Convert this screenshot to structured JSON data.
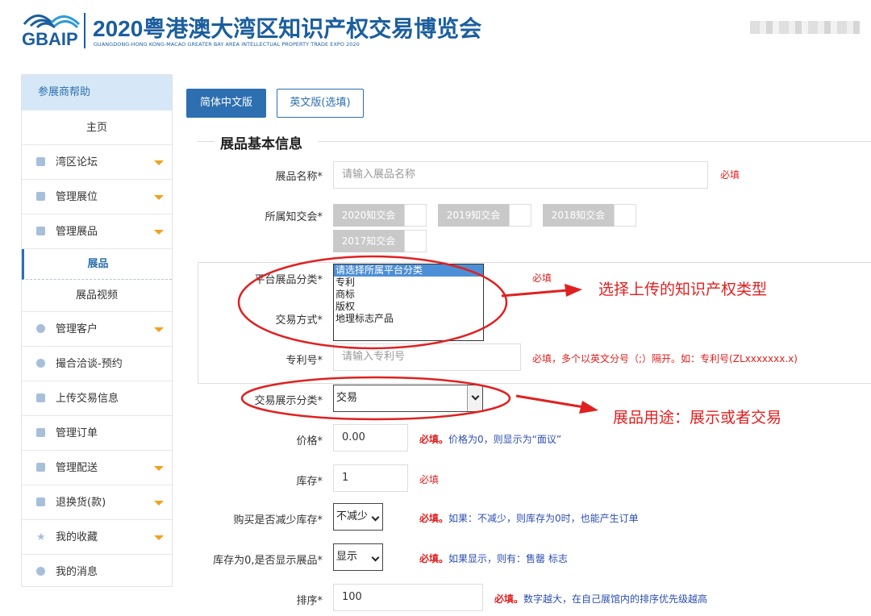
{
  "header": {
    "logo_text": "GBAIP",
    "title": "2020粤港澳大湾区知识产权交易博览会",
    "subtitle": "GUANGDONG-HONG KONG-MACAO GREATER BAY AREA INTELLECTUAL PROPERTY TRADE EXPO 2020",
    "brand_color": "#1b5e9e"
  },
  "sidebar": {
    "heading": "参展商帮助",
    "items": [
      {
        "label": "主页",
        "icon": "none",
        "expandable": false
      },
      {
        "label": "湾区论坛",
        "icon": "forum-icon",
        "expandable": true
      },
      {
        "label": "管理展位",
        "icon": "booth-icon",
        "expandable": true
      },
      {
        "label": "管理展品",
        "icon": "grid-icon",
        "expandable": true
      },
      {
        "label": "展品",
        "icon": "none",
        "expandable": false,
        "active": true
      },
      {
        "label": "展品视频",
        "icon": "none",
        "expandable": false
      },
      {
        "label": "管理客户",
        "icon": "user-icon",
        "expandable": true
      },
      {
        "label": "撮合洽谈-预约",
        "icon": "chat-icon",
        "expandable": false
      },
      {
        "label": "上传交易信息",
        "icon": "upload-icon",
        "expandable": false
      },
      {
        "label": "管理订单",
        "icon": "order-icon",
        "expandable": false
      },
      {
        "label": "管理配送",
        "icon": "truck-icon",
        "expandable": true
      },
      {
        "label": "退换货(款)",
        "icon": "return-icon",
        "expandable": true
      },
      {
        "label": "我的收藏",
        "icon": "star-icon",
        "expandable": true
      },
      {
        "label": "我的消息",
        "icon": "message-icon",
        "expandable": false
      }
    ]
  },
  "tabs": {
    "simplified": "简体中文版",
    "english": "英文版(选填)"
  },
  "section_title": "展品基本信息",
  "form": {
    "name_label": "展品名称*",
    "name_placeholder": "请输入展品名称",
    "name_req": "必填",
    "expo_label": "所属知交会*",
    "expo_options": [
      "2020知交会",
      "2019知交会",
      "2018知交会",
      "2017知交会"
    ],
    "category_label": "平台展品分类*",
    "category_options": [
      "请选择所属平台分类",
      "专利",
      "商标",
      "版权",
      "地理标志产品"
    ],
    "category_req": "必填",
    "trade_label": "交易方式*",
    "patent_label": "专利号*",
    "patent_placeholder": "请输入专利号",
    "patent_note": "必填，多个以英文分号（;）隔开。如：专利号(ZLxxxxxxx.x)",
    "display_label": "交易展示分类*",
    "display_value": "交易",
    "price_label": "价格*",
    "price_value": "0.00",
    "price_req": "必填。",
    "price_note": "价格为0，则显示为“面议”",
    "stock_label": "库存*",
    "stock_value": "1",
    "stock_req": "必填",
    "reduce_label": "购买是否减少库存*",
    "reduce_value": "不减少",
    "reduce_req": "必填。",
    "reduce_note": "如果：不减少，则库存为0时，也能产生订单",
    "zero_label": "库存为0,是否显示展品*",
    "zero_value": "显示",
    "zero_req": "必填。",
    "zero_note": "如果显示，则有：售罄 标志",
    "sort_label": "排序*",
    "sort_value": "100",
    "sort_req": "必填。",
    "sort_note": "数字越大，在自己展馆内的排序优先级越高"
  },
  "annotations": {
    "callout_1": "选择上传的知识产权类型",
    "callout_2": "展品用途：展示或者交易",
    "color": "#e02020"
  }
}
